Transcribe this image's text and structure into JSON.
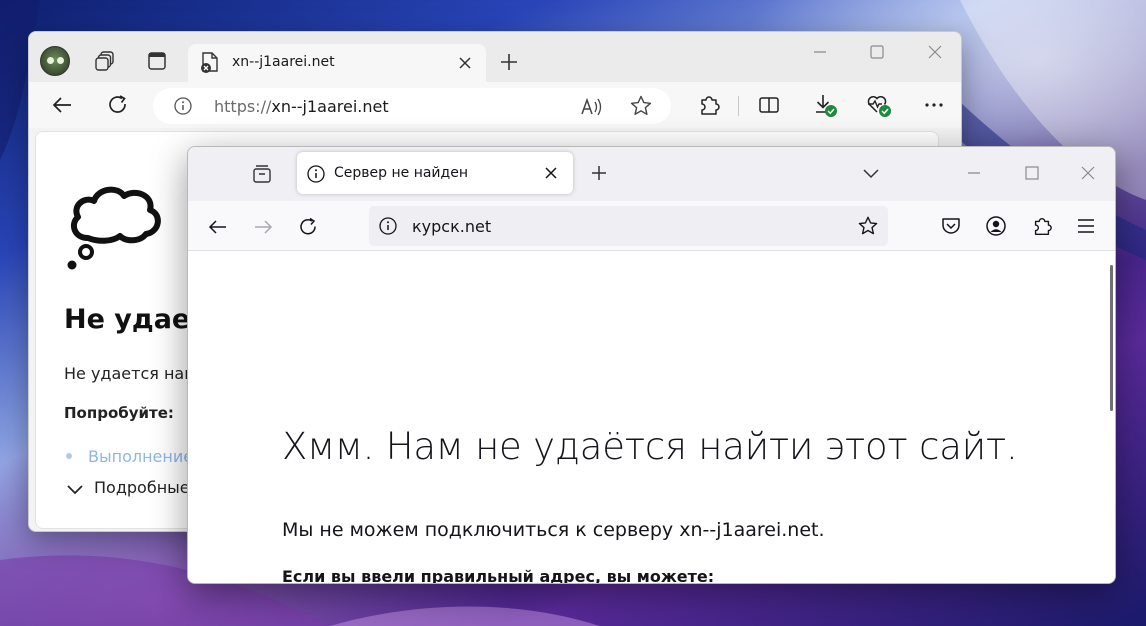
{
  "edge": {
    "tab": {
      "title": "xn--j1aarei.net"
    },
    "address": {
      "protocol": "https://",
      "host": "xn--j1aarei.net"
    },
    "error": {
      "heading": "Не удает",
      "message": "Не удается найт",
      "try_label": "Попробуйте:",
      "suggestion": "Выполнение",
      "details": "Подробные"
    }
  },
  "firefox": {
    "tab": {
      "title": "Сервер не найден"
    },
    "address": {
      "url": "курск.net"
    },
    "error": {
      "heading": "Хмм. Нам не удаётся найти этот сайт.",
      "message": "Мы не можем подключиться к серверу xn--j1aarei.net.",
      "subheading": "Если вы ввели правильный адрес, вы можете:"
    }
  },
  "icons": {
    "edge_favicon": "page-error-icon",
    "edge_address_info": "info-icon",
    "read_aloud": "read-aloud-icon",
    "favorite": "star-icon",
    "extensions": "puzzle-icon",
    "split_screen": "split-screen-icon",
    "downloads": "download-icon",
    "browser_essentials": "heart-pulse-icon",
    "more": "more-icon"
  },
  "colors": {
    "edge_tabbar": "#ebebeb",
    "firefox_tabbar": "#f0f0f4",
    "success_badge": "#1f8a3b",
    "link_muted": "#8fb7e6"
  }
}
